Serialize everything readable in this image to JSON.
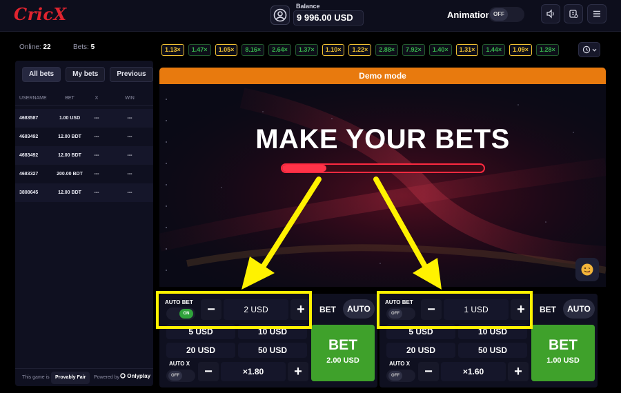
{
  "header": {
    "logo": "CricX",
    "balance_label": "Balance",
    "balance_value": "9 996.00 USD",
    "animation_label": "Animation",
    "animation_toggle": "OFF"
  },
  "lobby": {
    "online_label": "Online:",
    "online_value": "22",
    "bets_label": "Bets:",
    "bets_value": "5"
  },
  "left_panel": {
    "tabs": [
      {
        "label": "All bets"
      },
      {
        "label": "My bets"
      },
      {
        "label": "Previous"
      }
    ],
    "columns": [
      "USERNAME",
      "BET",
      "X",
      "WIN"
    ],
    "rows": [
      {
        "username": "4683587",
        "bet": "1.00 USD",
        "x": "---",
        "win": "---"
      },
      {
        "username": "4683492",
        "bet": "12.00 BDT",
        "x": "---",
        "win": "---"
      },
      {
        "username": "4683492",
        "bet": "12.00 BDT",
        "x": "---",
        "win": "---"
      },
      {
        "username": "4683327",
        "bet": "200.00 BDT",
        "x": "---",
        "win": "---"
      },
      {
        "username": "3808645",
        "bet": "12.00 BDT",
        "x": "---",
        "win": "---"
      }
    ],
    "footer": {
      "game_is": "This game is",
      "provably_fair": "Provably Fair",
      "powered_by": "Powered by",
      "provider": "Onlyplay"
    }
  },
  "multipliers": [
    {
      "value": "1.13×",
      "color": "yellow"
    },
    {
      "value": "1.47×",
      "color": "green"
    },
    {
      "value": "1.05×",
      "color": "yellow"
    },
    {
      "value": "8.16×",
      "color": "green"
    },
    {
      "value": "2.64×",
      "color": "green"
    },
    {
      "value": "1.37×",
      "color": "green"
    },
    {
      "value": "1.10×",
      "color": "yellow"
    },
    {
      "value": "1.22×",
      "color": "yellow"
    },
    {
      "value": "2.88×",
      "color": "green"
    },
    {
      "value": "7.92×",
      "color": "green"
    },
    {
      "value": "1.40×",
      "color": "green"
    },
    {
      "value": "1.31×",
      "color": "yellow"
    },
    {
      "value": "1.44×",
      "color": "green"
    },
    {
      "value": "1.09×",
      "color": "yellow"
    },
    {
      "value": "1.28×",
      "color": "green"
    }
  ],
  "game": {
    "demo_label": "Demo mode",
    "headline": "MAKE YOUR BETS",
    "countdown_progress": 0.22
  },
  "bet_panels": [
    {
      "autobet_label": "AUTO BET",
      "autobet_toggle": "ON",
      "amount": "2 USD",
      "mode_bet": "BET",
      "mode_auto": "AUTO",
      "presets": [
        "5 USD",
        "10 USD",
        "20 USD",
        "50 USD"
      ],
      "autox_label": "AUTO X",
      "autox_toggle": "OFF",
      "autox_value": "×1.80",
      "bet_button": "BET",
      "bet_amount": "2.00 USD"
    },
    {
      "autobet_label": "AUTO BET",
      "autobet_toggle": "OFF",
      "amount": "1 USD",
      "mode_bet": "BET",
      "mode_auto": "AUTO",
      "presets": [
        "5 USD",
        "10 USD",
        "20 USD",
        "50 USD"
      ],
      "autox_label": "AUTO X",
      "autox_toggle": "OFF",
      "autox_value": "×1.60",
      "bet_button": "BET",
      "bet_amount": "1.00 USD"
    }
  ],
  "colors": {
    "brand_red": "#e0242f",
    "demo_orange": "#e87a0e",
    "bet_green": "#3fa12b",
    "highlight_yellow": "#fff200",
    "multiplier_yellow": "#f1c232",
    "multiplier_green": "#37b44c"
  },
  "icons": {
    "avatar": "user-circle-icon",
    "sound": "speaker-icon",
    "wallet": "wallet-icon",
    "menu": "hamburger-menu-icon",
    "history": "history-clock-icon",
    "emoji": "emoji-face-icon"
  }
}
